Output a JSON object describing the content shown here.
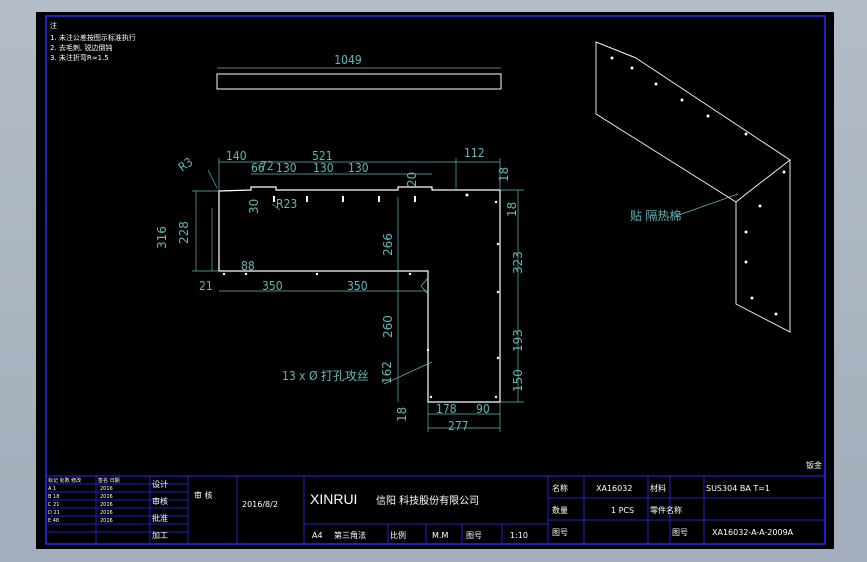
{
  "notes": {
    "header": "注",
    "items": [
      "1. 未注公差按图示标准执行",
      "2. 去毛刺, 锐边倒钝",
      "3. 未注折弯R≈1.5"
    ]
  },
  "dims": {
    "d1049": "1049",
    "d140": "140",
    "d521": "521",
    "dR3": "R3",
    "d112": "112",
    "d66": "66",
    "d72": "72",
    "d130a": "130",
    "d130b": "130",
    "d130c": "130",
    "d20": "20",
    "d18a": "18",
    "d30": "30",
    "dR23": "R23",
    "d18b": "18",
    "d316": "316",
    "d228": "228",
    "d266": "266",
    "d323": "323",
    "d88": "88",
    "d21": "21",
    "d350a": "350",
    "d350b": "350",
    "d260": "260",
    "d193": "193",
    "d162": "162",
    "d150": "150",
    "d18c": "18",
    "d178": "178",
    "d90": "90",
    "d277": "277"
  },
  "callouts": {
    "holes": "13 x Ø   打孔攻丝",
    "paste": "贴  隔热棉"
  },
  "corner_mark": "钣金",
  "title_block": {
    "company_en": "XINRUI",
    "company_cn": "信阳  科技股份有限公司",
    "date": "2016/8/2",
    "approver": "审  核",
    "format": "A4",
    "view": "第三角法",
    "unit": "M.M",
    "scale": "1:10",
    "model": "XA16032",
    "material": "SUS304  BA  T=1",
    "qty": "1  PCS",
    "drawing_no": "XA16032-A-A-2009A",
    "name_label": "名称",
    "figure_label": "图号",
    "part_label": "零件名称",
    "material_label": "材料",
    "qty_label": "数量",
    "process_label": "加工",
    "design_label": "设计",
    "check_label": "审核",
    "approve_label": "批准",
    "ratio_label": "比例",
    "drawing_no_label": "图号",
    "rev_labels": [
      "标记 处数 修改",
      "签名 日期"
    ],
    "rev_left": [
      "A  1",
      "B  18",
      "C  21",
      "D  21",
      "E  48"
    ],
    "rev_mid": [
      "2016",
      "2016",
      "2016",
      "2016",
      "2016"
    ]
  },
  "colors": {
    "background": "#000000",
    "border": "#2a2aff",
    "dimension": "#5fb8b8",
    "outline": "#ffffff"
  }
}
